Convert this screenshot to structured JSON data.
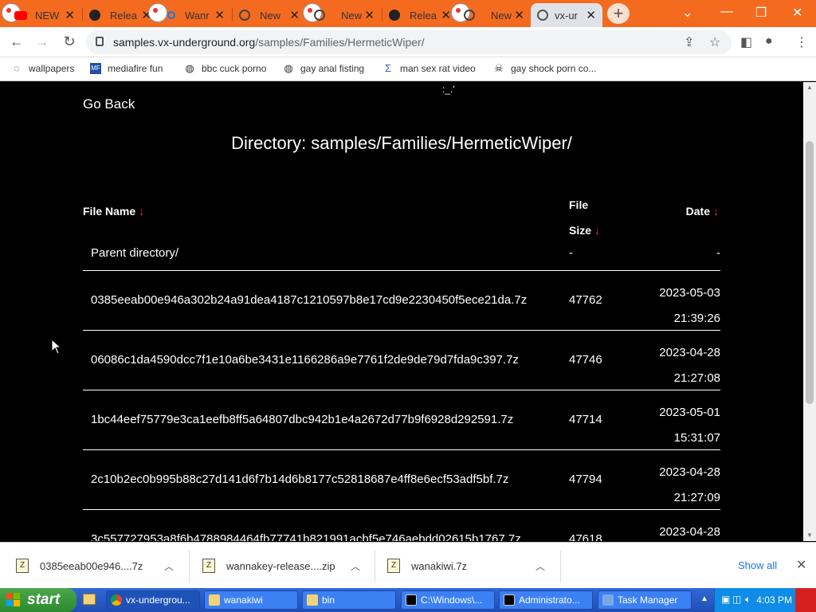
{
  "browser": {
    "tabs": [
      {
        "label": "NEW",
        "icon": "youtube-icon"
      },
      {
        "label": "Relea",
        "icon": "github-icon"
      },
      {
        "label": "Wanr",
        "icon": "search-icon"
      },
      {
        "label": "New",
        "icon": "globe-icon"
      },
      {
        "label": "New",
        "icon": "globe-icon"
      },
      {
        "label": "Relea",
        "icon": "github-icon"
      },
      {
        "label": "New",
        "icon": "globe-icon"
      },
      {
        "label": "vx-ur",
        "icon": "globe-icon",
        "active": true
      }
    ],
    "url_host": "samples.vx-underground.org",
    "url_path": "/samples/Families/HermeticWiper/",
    "bookmarks": [
      {
        "label": "wallpapers"
      },
      {
        "label": "mediafire fun"
      },
      {
        "label": "bbc cuck porno"
      },
      {
        "label": "gay anal fisting"
      },
      {
        "label": "man sex rat video"
      },
      {
        "label": "gay shock porn co..."
      }
    ]
  },
  "page": {
    "go_back": "Go Back",
    "tiny_mark": ":_.'",
    "title": "Directory: samples/Families/HermeticWiper/",
    "headers": {
      "name": "File Name",
      "size_line1": "File",
      "size_line2": "Size",
      "date": "Date",
      "arrow": "↓"
    },
    "parent": {
      "name": "Parent directory/",
      "size": "-",
      "date": "-"
    },
    "files": [
      {
        "name": "0385eeab00e946a302b24a91dea4187c1210597b8e17cd9e2230450f5ece21da.7z",
        "size": "47762",
        "date": "2023-05-03",
        "time": "21:39:26"
      },
      {
        "name": "06086c1da4590dcc7f1e10a6be3431e1166286a9e7761f2de9de79d7fda9c397.7z",
        "size": "47746",
        "date": "2023-04-28",
        "time": "21:27:08"
      },
      {
        "name": "1bc44eef75779e3ca1eefb8ff5a64807dbc942b1e4a2672d77b9f6928d292591.7z",
        "size": "47714",
        "date": "2023-05-01",
        "time": "15:31:07"
      },
      {
        "name": "2c10b2ec0b995b88c27d141d6f7b14d6b8177c52818687e4ff8e6ecf53adf5bf.7z",
        "size": "47794",
        "date": "2023-04-28",
        "time": "21:27:09"
      },
      {
        "name": "3c557727953a8f6b4788984464fb77741b821991acbf5e746aebdd02615b1767.7z",
        "size": "47618",
        "date": "2023-04-28",
        "time": ""
      }
    ]
  },
  "downloads": {
    "items": [
      {
        "label": "0385eeab00e946....7z"
      },
      {
        "label": "wannakey-release....zip"
      },
      {
        "label": "wanakiwi.7z"
      }
    ],
    "show_all": "Show all"
  },
  "taskbar": {
    "start": "start",
    "buttons": [
      {
        "label": "vx-undergrou...",
        "active": true
      },
      {
        "label": "wanakiwi"
      },
      {
        "label": "bin"
      },
      {
        "label": "C:\\Windows\\..."
      },
      {
        "label": "Administrato..."
      },
      {
        "label": "Task Manager"
      }
    ],
    "clock": "4:03 PM"
  },
  "colors": {
    "tabstrip": "#f46b1f",
    "page_bg": "#000000",
    "sort_arrow": "#e33333",
    "taskbar": "#2459c7",
    "start_button": "#3d9a3d"
  }
}
